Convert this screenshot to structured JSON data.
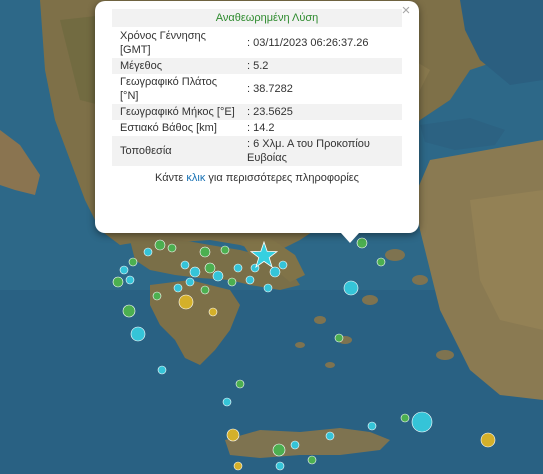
{
  "popup": {
    "title": "Αναθεωρημένη Λύση",
    "close_label": "×",
    "rows": [
      {
        "label": "Χρόνος Γέννησης [GMT]",
        "value": ": 03/11/2023 06:26:37.26"
      },
      {
        "label": "Μέγεθος",
        "value": ": 5.2"
      },
      {
        "label": "Γεωγραφικό Πλάτος [°N]",
        "value": ": 38.7282"
      },
      {
        "label": "Γεωγραφικό Μήκος [°E]",
        "value": ": 23.5625"
      },
      {
        "label": "Εστιακό Βάθος [km]",
        "value": ": 14.2"
      },
      {
        "label": "Τοποθεσία",
        "value": ": 6 Χλμ. Α του Προκοπίου Ευβοίας"
      }
    ],
    "footer_before": "Κάντε ",
    "footer_link": "κλικ",
    "footer_after": " για περισσότερες πληροφορίες"
  },
  "map": {
    "colors": {
      "sea": "#2f6a8a",
      "land": "#8a7a55",
      "green": "#4caf50",
      "cyan": "#35c4d8",
      "yellow": "#d4b02a",
      "star": "#35d0e0"
    },
    "main_event_icon": "star-icon"
  }
}
